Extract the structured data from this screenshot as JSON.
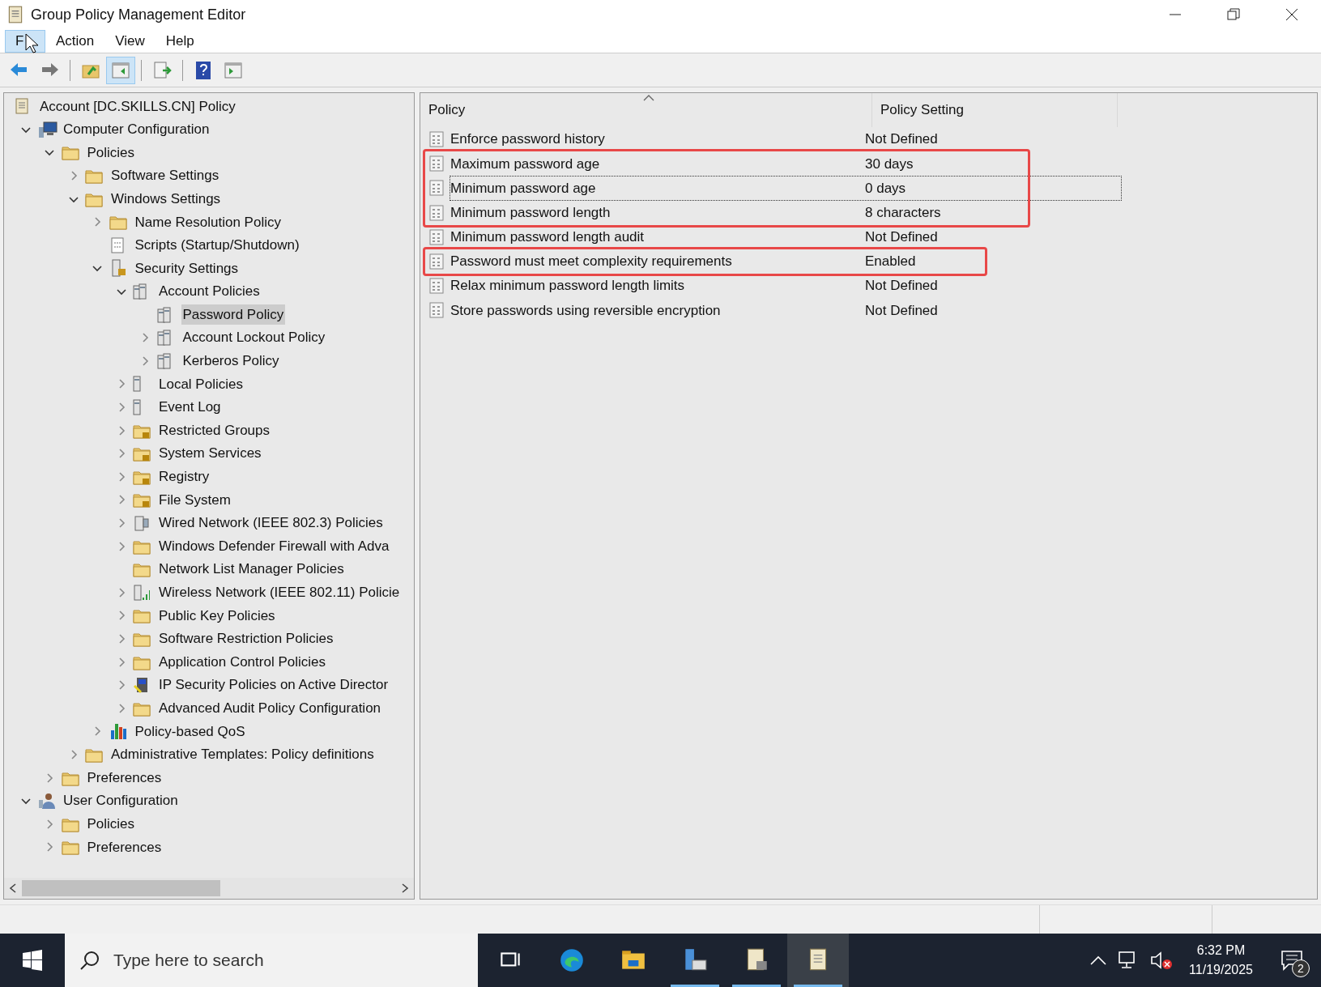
{
  "window": {
    "title": "Group Policy Management Editor"
  },
  "menu": [
    {
      "label": "F",
      "selected": true
    },
    {
      "label": "Action",
      "selected": false
    },
    {
      "label": "View",
      "selected": false
    },
    {
      "label": "Help",
      "selected": false
    }
  ],
  "toolbar": [
    {
      "kind": "back"
    },
    {
      "kind": "forward"
    },
    {
      "kind": "sep"
    },
    {
      "kind": "up"
    },
    {
      "kind": "tree",
      "selected": true
    },
    {
      "kind": "sep"
    },
    {
      "kind": "export"
    },
    {
      "kind": "sep"
    },
    {
      "kind": "help"
    },
    {
      "kind": "pane"
    }
  ],
  "tree": {
    "root": {
      "label": "Account [DC.SKILLS.CN] Policy",
      "kind": "scroll",
      "selected": false
    },
    "items": [
      {
        "label": "Computer Configuration",
        "kind": "computer",
        "expandable": true,
        "expanded": true,
        "selected": false,
        "children": [
          {
            "label": "Policies",
            "kind": "folder",
            "expandable": true,
            "expanded": true,
            "selected": false,
            "children": [
              {
                "label": "Software Settings",
                "kind": "folder",
                "expandable": true,
                "expanded": false,
                "selected": false
              },
              {
                "label": "Windows Settings",
                "kind": "folder",
                "expandable": true,
                "expanded": true,
                "selected": false,
                "children": [
                  {
                    "label": "Name Resolution Policy",
                    "kind": "folder",
                    "expandable": true,
                    "expanded": false,
                    "selected": false
                  },
                  {
                    "label": "Scripts (Startup/Shutdown)",
                    "kind": "script",
                    "expandable": false,
                    "selected": false
                  },
                  {
                    "label": "Security Settings",
                    "kind": "serverlock",
                    "expandable": true,
                    "expanded": true,
                    "selected": false,
                    "children": [
                      {
                        "label": "Account Policies",
                        "kind": "servers",
                        "expandable": true,
                        "expanded": true,
                        "selected": false,
                        "children": [
                          {
                            "label": "Password Policy",
                            "kind": "servers",
                            "expandable": false,
                            "selected": true
                          },
                          {
                            "label": "Account Lockout Policy",
                            "kind": "servers",
                            "expandable": true,
                            "expanded": false,
                            "selected": false
                          },
                          {
                            "label": "Kerberos Policy",
                            "kind": "servers",
                            "expandable": true,
                            "expanded": false,
                            "selected": false
                          }
                        ]
                      },
                      {
                        "label": "Local Policies",
                        "kind": "server",
                        "expandable": true,
                        "expanded": false,
                        "selected": false
                      },
                      {
                        "label": "Event Log",
                        "kind": "server",
                        "expandable": true,
                        "expanded": false,
                        "selected": false
                      },
                      {
                        "label": "Restricted Groups",
                        "kind": "folderlock",
                        "expandable": true,
                        "expanded": false,
                        "selected": false
                      },
                      {
                        "label": "System Services",
                        "kind": "folderlock",
                        "expandable": true,
                        "expanded": false,
                        "selected": false
                      },
                      {
                        "label": "Registry",
                        "kind": "folderlock",
                        "expandable": true,
                        "expanded": false,
                        "selected": false
                      },
                      {
                        "label": "File System",
                        "kind": "folderlock",
                        "expandable": true,
                        "expanded": false,
                        "selected": false
                      },
                      {
                        "label": "Wired Network (IEEE 802.3) Policies",
                        "kind": "network",
                        "expandable": true,
                        "expanded": false,
                        "selected": false
                      },
                      {
                        "label": "Windows Defender Firewall with Adva",
                        "kind": "folder",
                        "expandable": true,
                        "expanded": false,
                        "selected": false
                      },
                      {
                        "label": "Network List Manager Policies",
                        "kind": "folder",
                        "expandable": false,
                        "selected": false
                      },
                      {
                        "label": "Wireless Network (IEEE 802.11) Policie",
                        "kind": "wireless",
                        "expandable": true,
                        "expanded": false,
                        "selected": false
                      },
                      {
                        "label": "Public Key Policies",
                        "kind": "folder",
                        "expandable": true,
                        "expanded": false,
                        "selected": false
                      },
                      {
                        "label": "Software Restriction Policies",
                        "kind": "folder",
                        "expandable": true,
                        "expanded": false,
                        "selected": false
                      },
                      {
                        "label": "Application Control Policies",
                        "kind": "folder",
                        "expandable": true,
                        "expanded": false,
                        "selected": false
                      },
                      {
                        "label": "IP Security Policies on Active Director",
                        "kind": "ipsec",
                        "expandable": true,
                        "expanded": false,
                        "selected": false
                      },
                      {
                        "label": "Advanced Audit Policy Configuration",
                        "kind": "folder",
                        "expandable": true,
                        "expanded": false,
                        "selected": false
                      }
                    ]
                  },
                  {
                    "label": "Policy-based QoS",
                    "kind": "qos",
                    "expandable": true,
                    "expanded": false,
                    "selected": false
                  }
                ]
              },
              {
                "label": "Administrative Templates: Policy definitions",
                "kind": "folder",
                "expandable": true,
                "expanded": false,
                "selected": false
              }
            ]
          },
          {
            "label": "Preferences",
            "kind": "folder",
            "expandable": true,
            "expanded": false,
            "selected": false
          }
        ]
      },
      {
        "label": "User Configuration",
        "kind": "user",
        "expandable": true,
        "expanded": true,
        "selected": false,
        "children": [
          {
            "label": "Policies",
            "kind": "folder",
            "expandable": true,
            "expanded": false,
            "selected": false
          },
          {
            "label": "Preferences",
            "kind": "folder",
            "expandable": true,
            "expanded": false,
            "selected": false
          }
        ]
      }
    ]
  },
  "table": {
    "columns": [
      "Policy",
      "Policy Setting"
    ],
    "rows": [
      {
        "policy": "Enforce password history",
        "setting": "Not Defined",
        "highlighted": false,
        "focused": false
      },
      {
        "policy": "Maximum password age",
        "setting": "30 days",
        "highlighted": true,
        "focused": false
      },
      {
        "policy": "Minimum password age",
        "setting": "0 days",
        "highlighted": true,
        "focused": true
      },
      {
        "policy": "Minimum password length",
        "setting": "8 characters",
        "highlighted": true,
        "focused": false
      },
      {
        "policy": "Minimum password length audit",
        "setting": "Not Defined",
        "highlighted": false,
        "focused": false
      },
      {
        "policy": "Password must meet complexity requirements",
        "setting": "Enabled",
        "highlighted": true,
        "focused": false
      },
      {
        "policy": "Relax minimum password length limits",
        "setting": "Not Defined",
        "highlighted": false,
        "focused": false
      },
      {
        "policy": "Store passwords using reversible encryption",
        "setting": "Not Defined",
        "highlighted": false,
        "focused": false
      }
    ]
  },
  "taskbar": {
    "search": {
      "placeholder": "Type here to search"
    },
    "apps": [
      {
        "kind": "taskview",
        "active": false
      },
      {
        "kind": "edge",
        "active": false
      },
      {
        "kind": "explorer",
        "active": false
      },
      {
        "kind": "servermanager",
        "active": true
      },
      {
        "kind": "gpm",
        "active": true
      },
      {
        "kind": "gpedit",
        "active": true,
        "selected": true
      }
    ],
    "time": "6:32 PM",
    "date": "11/19/2025",
    "notifications": "2"
  }
}
